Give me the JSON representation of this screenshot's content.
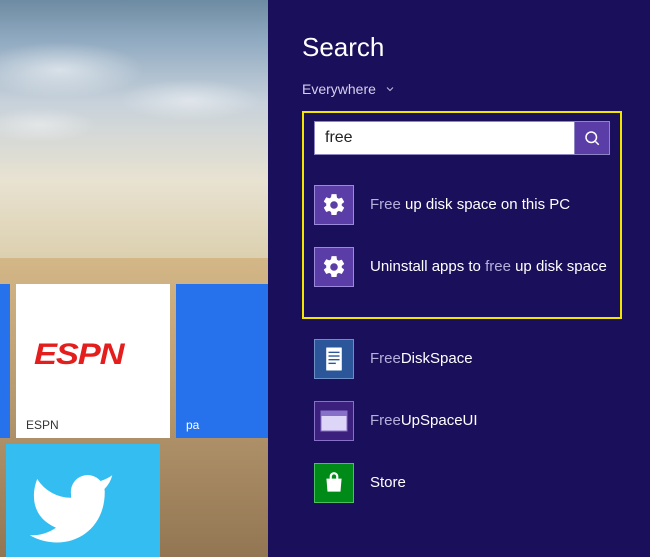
{
  "desktop": {
    "tile_espn": {
      "logo": "ESPN",
      "label": "ESPN"
    },
    "tile_blue": {
      "label": "pa"
    }
  },
  "search": {
    "title": "Search",
    "scope_label": "Everywhere",
    "query": "free",
    "highlighted": [
      {
        "pre": "Free ",
        "hl": "up disk space on this PC",
        "post": ""
      },
      {
        "pre": "Uninstall apps to ",
        "hl": "free ",
        "post": "up disk space"
      }
    ],
    "results": [
      {
        "icon": "word",
        "pre": "Free",
        "hl": "DiskSpace",
        "post": ""
      },
      {
        "icon": "ui",
        "pre": "Free",
        "hl": "UpSpaceUI",
        "post": ""
      },
      {
        "icon": "store",
        "pre": "",
        "hl": "Store",
        "post": ""
      }
    ]
  }
}
